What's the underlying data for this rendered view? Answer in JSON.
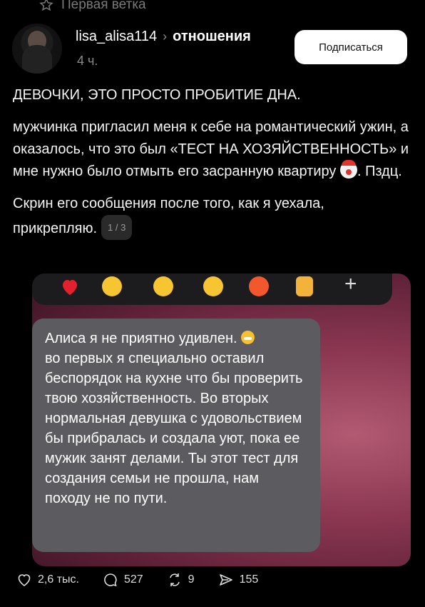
{
  "branch": {
    "label": "Первая ветка",
    "icon": "star-icon"
  },
  "author": {
    "username": "lisa_alisa114",
    "topic": "отношения",
    "time": "4 ч."
  },
  "subscribe_label": "Подписаться",
  "post": {
    "heading": "ДЕВОЧКИ, ЭТО ПРОСТО ПРОБИТИЕ ДНА.",
    "paragraph1_before_emoji": "мужчинка пригласил меня к себе на романтический ужин, а оказалось, что это был «ТЕСТ НА ХОЗЯЙСТВЕННОСТЬ» и мне нужно было отмыть его засранную квартиру",
    "paragraph1_after_emoji": ". Пздц.",
    "paragraph2": "Скрин его сообщения после того, как я уехала, прикрепляю.",
    "image_counter": "1 / 3"
  },
  "attachment": {
    "reactions": [
      "heart",
      "tears-of-joy",
      "surprised",
      "crying",
      "angry",
      "thumbs-up",
      "plus"
    ],
    "message_before_emoji": "Алиса я не приятно удивлен.",
    "message_after_emoji": "во первых я специально оставил беспорядок на кухне что бы проверить твою хозяйственность. Во вторых нормальная девушка с удовольствием бы прибралась и создала уют, пока ее мужик занят делами. Ты этот тест  для создания семьи не прошла, нам походу не по пути."
  },
  "actions": {
    "likes": "2,6 тыс.",
    "comments": "527",
    "reposts": "9",
    "shares": "155"
  }
}
